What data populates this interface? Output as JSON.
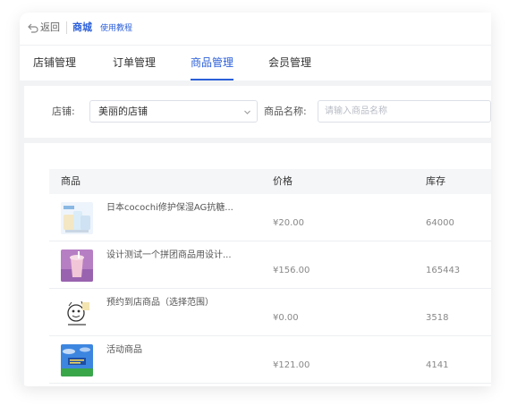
{
  "header": {
    "back_label": "返回",
    "title": "商城",
    "help_link": "使用教程"
  },
  "tabs": [
    {
      "label": "店铺管理",
      "active": false
    },
    {
      "label": "订单管理",
      "active": false
    },
    {
      "label": "商品管理",
      "active": true
    },
    {
      "label": "会员管理",
      "active": false
    }
  ],
  "filter": {
    "store_label": "店铺:",
    "store_value": "美丽的店铺",
    "name_label": "商品名称:",
    "name_placeholder": "请输入商品名称"
  },
  "table": {
    "columns": [
      "商品",
      "价格",
      "库存"
    ],
    "rows": [
      {
        "name": "日本cocochi修护保湿AG抗糖...",
        "price": "¥20.00",
        "stock": "64000",
        "thumb_icon": "skincare-product-icon"
      },
      {
        "name": "设计测试一个拼团商品用设计...",
        "price": "¥156.00",
        "stock": "165443",
        "thumb_icon": "milk-tea-drink-icon"
      },
      {
        "name": "预约到店商品（选择范围）",
        "price": "¥0.00",
        "stock": "3518",
        "thumb_icon": "cartoon-sketch-icon"
      },
      {
        "name": "活动商品",
        "price": "¥121.00",
        "stock": "4141",
        "thumb_icon": "sky-banner-icon"
      }
    ]
  },
  "colors": {
    "accent": "#2b5fd9",
    "page_bg": "#f2f3f5"
  }
}
